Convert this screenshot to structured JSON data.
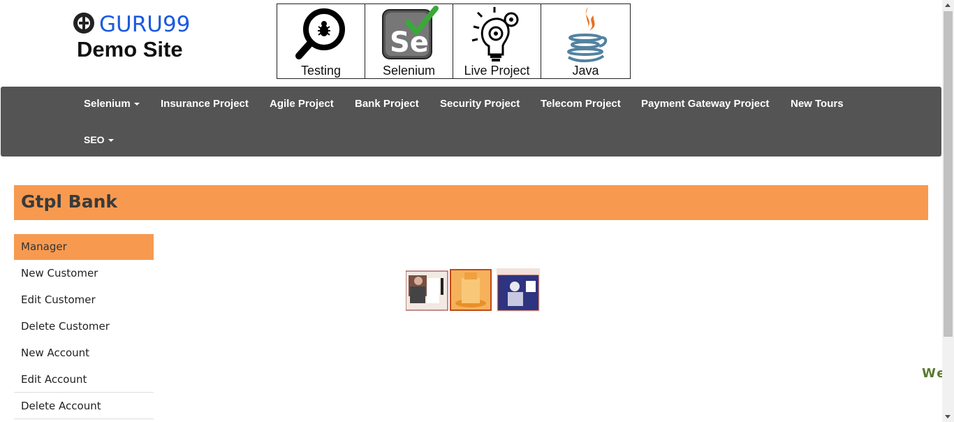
{
  "logo": {
    "brand": "GURU99",
    "subtitle": "Demo Site",
    "icon": "guru99-logo-icon"
  },
  "categories": [
    {
      "label": "Testing",
      "icon": "magnifier-bug-icon"
    },
    {
      "label": "Selenium",
      "icon": "selenium-se-icon"
    },
    {
      "label": "Live Project",
      "icon": "lightbulb-gears-icon"
    },
    {
      "label": "Java",
      "icon": "java-cup-icon"
    }
  ],
  "nav": {
    "items": [
      {
        "label": "Selenium",
        "dropdown": true
      },
      {
        "label": "Insurance Project"
      },
      {
        "label": "Agile Project"
      },
      {
        "label": "Bank Project"
      },
      {
        "label": "Security Project"
      },
      {
        "label": "Telecom Project"
      },
      {
        "label": "Payment Gateway Project"
      },
      {
        "label": "New Tours"
      },
      {
        "label": "SEO",
        "dropdown": true
      }
    ]
  },
  "bank": {
    "title": "Gtpl Bank"
  },
  "sidebar": {
    "items": [
      {
        "label": "Manager",
        "active": true
      },
      {
        "label": "New Customer"
      },
      {
        "label": "Edit Customer"
      },
      {
        "label": "Delete Customer"
      },
      {
        "label": "New Account"
      },
      {
        "label": "Edit Account"
      },
      {
        "label": "Delete Account"
      }
    ]
  },
  "marquee": {
    "text": "We"
  },
  "colors": {
    "accent": "#f79a50",
    "navbar": "#545454",
    "brand": "#1a5adf",
    "marquee": "#5a7a2e"
  }
}
